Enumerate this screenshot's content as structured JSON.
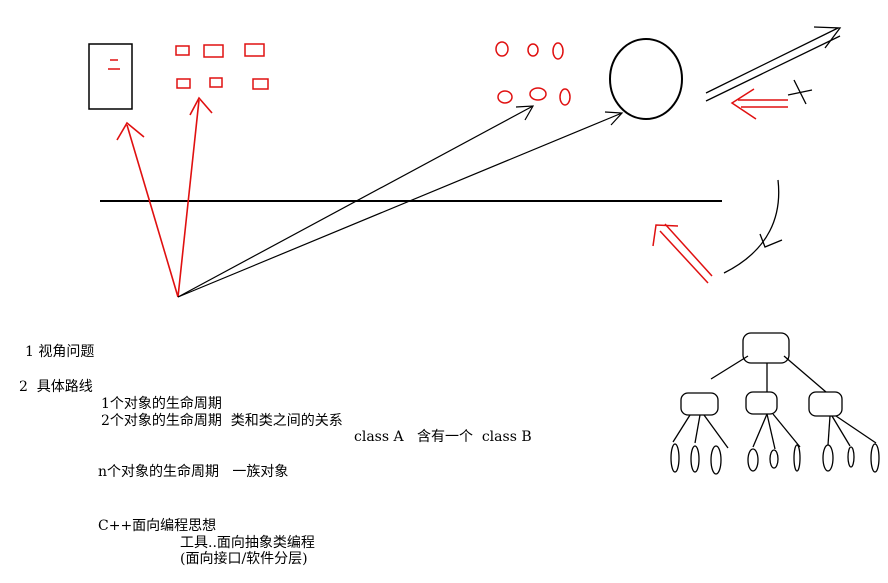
{
  "colors": {
    "ink": "#000000",
    "accent": "#e01010",
    "background": "#ffffff"
  },
  "notes": {
    "item1": "1 视角问题",
    "item2": "2  具体路线",
    "line_single": "1个对象的生命周期",
    "line_pair": "2个对象的生命周期  类和类之间的关系",
    "line_contains": "class A   含有一个  class B",
    "line_many": "n个对象的生命周期   一族对象",
    "line_cpp": "C++面向编程思想",
    "line_tools": "工具..面向抽象类编程",
    "line_layers": "(面向接口/软件分层)"
  }
}
